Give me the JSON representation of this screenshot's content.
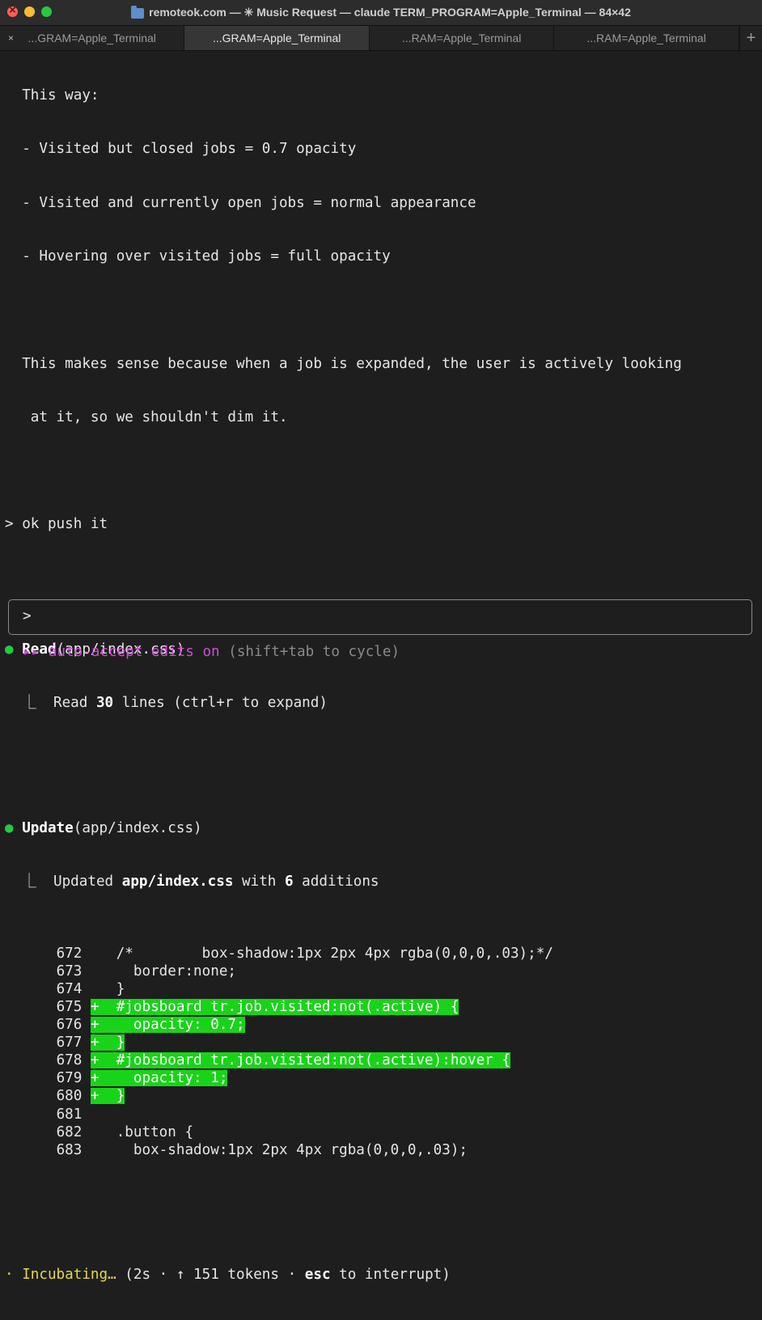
{
  "window": {
    "title": "remoteok.com — ✳ Music Request — claude TERM_PROGRAM=Apple_Terminal — 84×42"
  },
  "tabs": [
    {
      "label": "...GRAM=Apple_Terminal",
      "active": false,
      "close": "×"
    },
    {
      "label": "...GRAM=Apple_Terminal",
      "active": true
    },
    {
      "label": "...RAM=Apple_Terminal",
      "active": false
    },
    {
      "label": "...RAM=Apple_Terminal",
      "active": false
    }
  ],
  "tab_add": "+",
  "explanation": {
    "l1": "This way:",
    "l2": "- Visited but closed jobs = 0.7 opacity",
    "l3": "- Visited and currently open jobs = normal appearance",
    "l4": "- Hovering over visited jobs = full opacity",
    "l5": "This makes sense because when a job is expanded, the user is actively looking",
    "l6": " at it, so we shouldn't dim it."
  },
  "prompt": {
    "marker": ">",
    "text": "ok push it"
  },
  "read_action": {
    "bullet": "●",
    "tool": "Read",
    "arg": "(app/index.css)",
    "branch": "⎿",
    "result_pre": "Read ",
    "result_count": "30",
    "result_post": " lines (ctrl+r to expand)"
  },
  "update_action": {
    "bullet": "●",
    "tool": "Update",
    "arg": "(app/index.css)",
    "branch": "⎿",
    "result_pre": "Updated ",
    "result_file": "app/index.css",
    "result_mid": " with ",
    "result_count": "6",
    "result_post": " additions"
  },
  "diff": [
    {
      "num": "672",
      "sign": " ",
      "code": "  /*        box-shadow:1px 2px 4px rgba(0,0,0,.03);*/",
      "added": false
    },
    {
      "num": "673",
      "sign": " ",
      "code": "    border:none;",
      "added": false
    },
    {
      "num": "674",
      "sign": " ",
      "code": "  }",
      "added": false
    },
    {
      "num": "675",
      "sign": "+",
      "code": "  #jobsboard tr.job.visited:not(.active) {",
      "added": true
    },
    {
      "num": "676",
      "sign": "+",
      "code": "    opacity: 0.7;",
      "added": true
    },
    {
      "num": "677",
      "sign": "+",
      "code": "  }",
      "added": true
    },
    {
      "num": "678",
      "sign": "+",
      "code": "  #jobsboard tr.job.visited:not(.active):hover {",
      "added": true
    },
    {
      "num": "679",
      "sign": "+",
      "code": "    opacity: 1;",
      "added": true
    },
    {
      "num": "680",
      "sign": "+",
      "code": "  }",
      "added": true
    },
    {
      "num": "681",
      "sign": " ",
      "code": "",
      "added": false
    },
    {
      "num": "682",
      "sign": " ",
      "code": "  .button {",
      "added": false
    },
    {
      "num": "683",
      "sign": " ",
      "code": "    box-shadow:1px 2px 4px rgba(0,0,0,.03);",
      "added": false
    }
  ],
  "status": {
    "spinner": "·",
    "verb": "Incubating…",
    "detail_pre": " (2s · ↑ 151 tokens · ",
    "key": "esc",
    "detail_post": " to interrupt)"
  },
  "input": {
    "marker": ">"
  },
  "mode": {
    "arrows": "▸▸",
    "label": "auto-accept edits on",
    "hint": "(shift+tab to cycle)"
  },
  "colors": {
    "added_bg": "#18d418",
    "bullet_green": "#27c93f",
    "status_yellow": "#e6d64a",
    "mode_magenta": "#d24bd9"
  }
}
